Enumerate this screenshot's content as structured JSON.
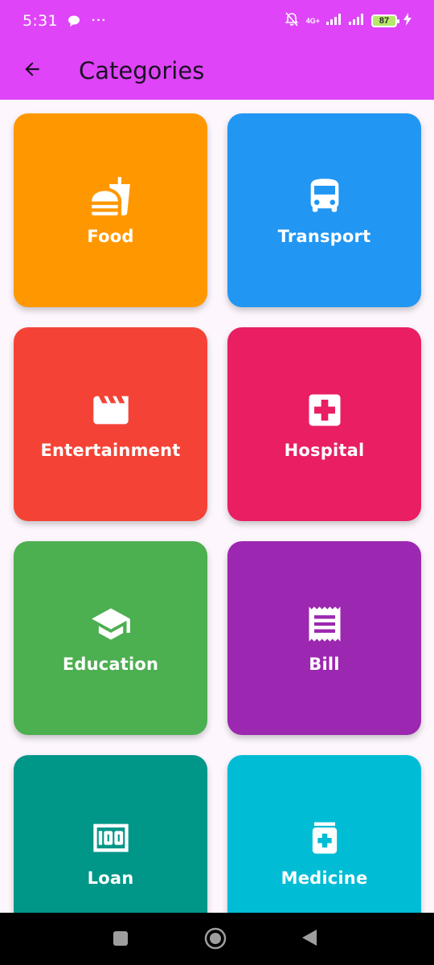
{
  "status_bar": {
    "time": "5:31",
    "dots": "···",
    "network": "4G+",
    "battery": "87"
  },
  "app_bar": {
    "title": "Categories"
  },
  "categories": [
    {
      "label": "Food",
      "color": "#ff9800",
      "icon": "fastfood-icon"
    },
    {
      "label": "Transport",
      "color": "#2196f3",
      "icon": "bus-icon"
    },
    {
      "label": "Entertainment",
      "color": "#f44336",
      "icon": "clapperboard-icon"
    },
    {
      "label": "Hospital",
      "color": "#e91e63",
      "icon": "hospital-icon"
    },
    {
      "label": "Education",
      "color": "#4caf50",
      "icon": "graduation-cap-icon"
    },
    {
      "label": "Bill",
      "color": "#9c27b0",
      "icon": "receipt-icon"
    },
    {
      "label": "Loan",
      "color": "#009688",
      "icon": "money-icon"
    },
    {
      "label": "Medicine",
      "color": "#00bcd4",
      "icon": "medication-icon"
    }
  ]
}
